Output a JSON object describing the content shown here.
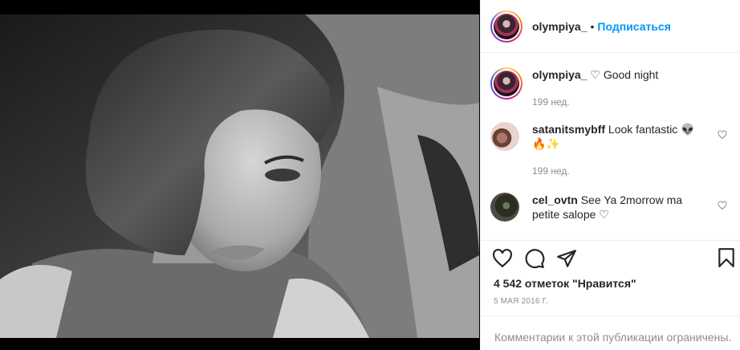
{
  "post": {
    "username": "olympiya_",
    "separator": "•",
    "follow_label": "Подписаться"
  },
  "comments": [
    {
      "user": "olympiya_",
      "text": "♡ Good night",
      "time": "199 нед."
    },
    {
      "user": "satanitsmybff",
      "text": "Look fantastic 👽 🔥✨",
      "time": "199 нед."
    },
    {
      "user": "cel_ovtn",
      "text": "See Ya 2morrow ma petite salope ♡",
      "time": ""
    }
  ],
  "engagement": {
    "likes_text": "4 542 отметок \"Нравится\"",
    "date": "5 мая 2016 г.",
    "comments_limited": "Комментарии к этой публикации ограничены."
  },
  "icons": {
    "like": "heart-icon",
    "comment": "comment-bubble-icon",
    "share": "paper-plane-icon",
    "save": "bookmark-icon"
  },
  "colors": {
    "accent": "#0095f6",
    "muted": "#8e8e8e",
    "text": "#262626",
    "divider": "#efefef"
  }
}
